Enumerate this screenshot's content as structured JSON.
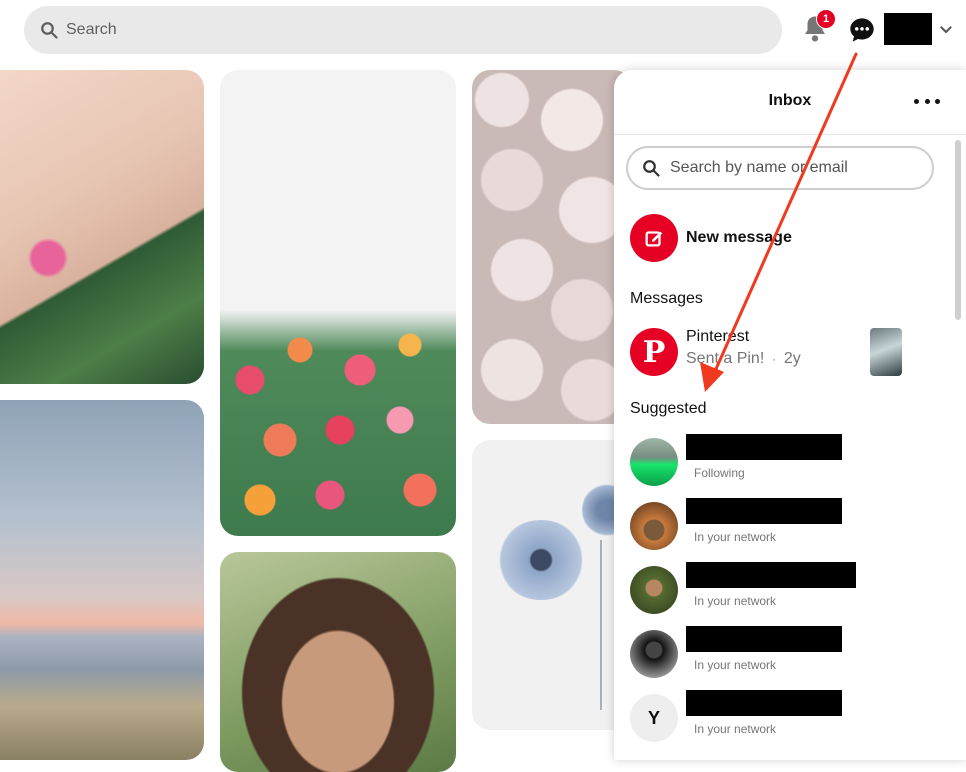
{
  "header": {
    "search_placeholder": "Search",
    "notification_count": "1",
    "brand_color": "#e60023"
  },
  "icons": {
    "search": "search-icon",
    "bell": "bell-icon",
    "messages": "chat-bubble-icon",
    "chevron": "chevron-down-icon",
    "more": "more-horizontal-icon",
    "edit": "edit-icon"
  },
  "inbox": {
    "title": "Inbox",
    "search_placeholder": "Search by name or email",
    "new_message_label": "New message",
    "messages_heading": "Messages",
    "conversations": [
      {
        "name": "Pinterest",
        "preview": "Sent a Pin!",
        "time": "2y"
      }
    ],
    "suggested_heading": "Suggested",
    "suggested": [
      {
        "status": "Following"
      },
      {
        "status": "In your network"
      },
      {
        "status": "In your network"
      },
      {
        "status": "In your network"
      },
      {
        "initial": "Y",
        "status": "In your network"
      }
    ]
  },
  "annotation": {
    "arrow_color": "#f0391f"
  }
}
